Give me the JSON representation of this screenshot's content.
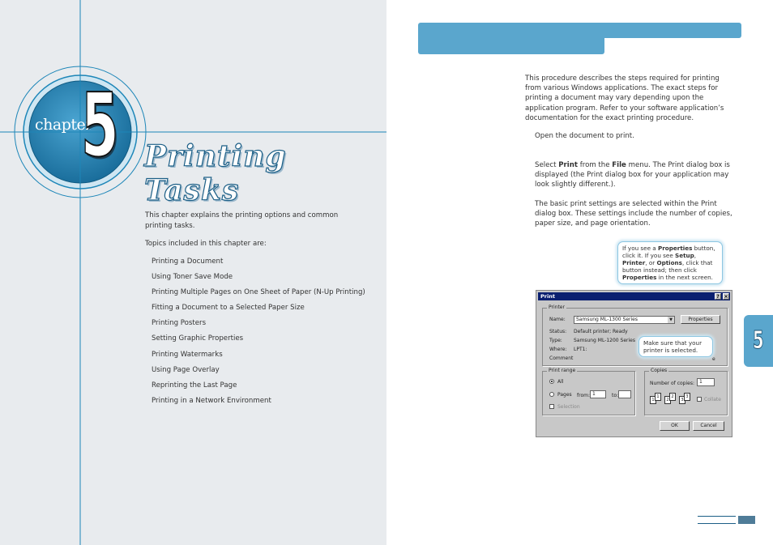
{
  "left_page": {
    "chapter_word": "chapter",
    "chapter_number": "5",
    "chapter_title": "Printing Tasks",
    "intro": "This chapter explains the printing options and common printing tasks.",
    "topics_lead": "Topics included in this chapter are:",
    "topics": [
      "Printing a Document",
      "Using Toner Save Mode",
      "Printing Multiple Pages on One Sheet of Paper (N-Up Printing)",
      "Fitting a Document to a Selected Paper Size",
      "Printing Posters",
      "Setting Graphic Properties",
      "Printing Watermarks",
      "Using Page Overlay",
      "Reprinting the Last Page",
      "Printing in a Network Environment"
    ]
  },
  "right_page": {
    "paragraph": "This procedure describes the steps required for printing from various Windows applications. The exact steps for printing a document may vary depending upon the application program. Refer to your software application’s documentation for the exact printing procedure.",
    "step1": "Open the document to print.",
    "step2": {
      "pre": "Select ",
      "print_word": "Print",
      "mid": " from the ",
      "file_word": "File",
      "post": " menu. The Print dialog box is displayed (the Print dialog box for your application may look slightly different.)."
    },
    "step2_note": "The basic print settings are selected within the Print dialog box. These settings include the number of copies, paper size, and page orientation.",
    "callout_properties": {
      "t1": "If you see a ",
      "b1": "Properties",
      "t2": " button, click it. If you see ",
      "b2": "Setup",
      "t3": ", ",
      "b3": "Printer",
      "t4": ", or ",
      "b4": "Options",
      "t5": ", click that button instead; then click ",
      "b5": "Properties",
      "t6": " in the next screen."
    },
    "callout_printer": "Make sure that your printer is selected.",
    "side_tab": "5"
  },
  "print_dialog": {
    "title": "Print",
    "help_button": "?",
    "close_button": "×",
    "printer_group": "Printer",
    "name_label": "Name:",
    "name_value": "Samsung ML-1300 Series",
    "properties_button": "Properties",
    "status_label": "Status:",
    "status_value": "Default printer; Ready",
    "type_label": "Type:",
    "type_value": "Samsung ML-1200 Series",
    "where_label": "Where:",
    "where_value": "LPT1:",
    "comment_label": "Comment",
    "print_to_file_fragment": "e",
    "print_range_group": "Print range",
    "all_option": "All",
    "pages_option": "Pages",
    "from_label": "from:",
    "from_value": "1",
    "to_label": "to:",
    "selection_option": "Selection",
    "copies_group": "Copies",
    "copies_label": "Number of copies:",
    "copies_value": "1",
    "collate_label": "Collate",
    "ok_button": "OK",
    "cancel_button": "Cancel",
    "page_icons": [
      "1",
      "1",
      "2",
      "2",
      "3",
      "3"
    ]
  }
}
